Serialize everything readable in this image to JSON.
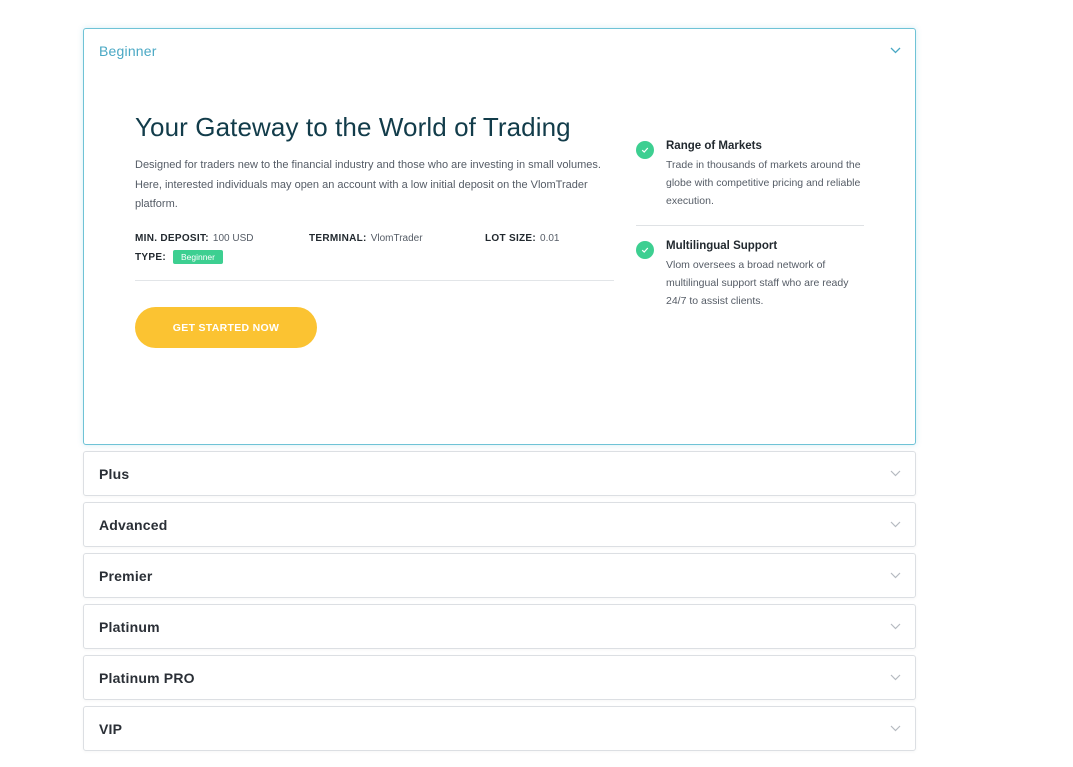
{
  "accordion": {
    "open": {
      "title": "Beginner",
      "headline": "Your Gateway to the World of Trading",
      "description": "Designed for traders new to the financial industry and those who are investing in small volumes. Here, interested individuals may open an account with a low initial deposit on the VlomTrader platform.",
      "meta": {
        "min_deposit_label": "MIN. DEPOSIT:",
        "min_deposit_value": "100 USD",
        "terminal_label": "TERMINAL:",
        "terminal_value": "VlomTrader",
        "lot_size_label": "LOT SIZE:",
        "lot_size_value": "0.01",
        "type_label": "TYPE:",
        "type_value": "Beginner"
      },
      "cta_label": "GET STARTED NOW",
      "features": [
        {
          "title": "Range of Markets",
          "desc": "Trade in thousands of markets around the globe with competitive pricing and reliable execution."
        },
        {
          "title": "Multilingual Support",
          "desc": "Vlom oversees a broad network of multilingual support staff who are ready 24/7 to assist clients."
        }
      ]
    },
    "collapsed": [
      "Plus",
      "Advanced",
      "Premier",
      "Platinum",
      "Platinum PRO",
      "VIP"
    ]
  },
  "colors": {
    "accent": "#4aa8c4",
    "cta": "#fbc332",
    "check": "#3dcf91",
    "headline": "#123c4a"
  },
  "icons": {
    "chevron": "chevron-down-icon",
    "check": "check-circle-icon"
  }
}
